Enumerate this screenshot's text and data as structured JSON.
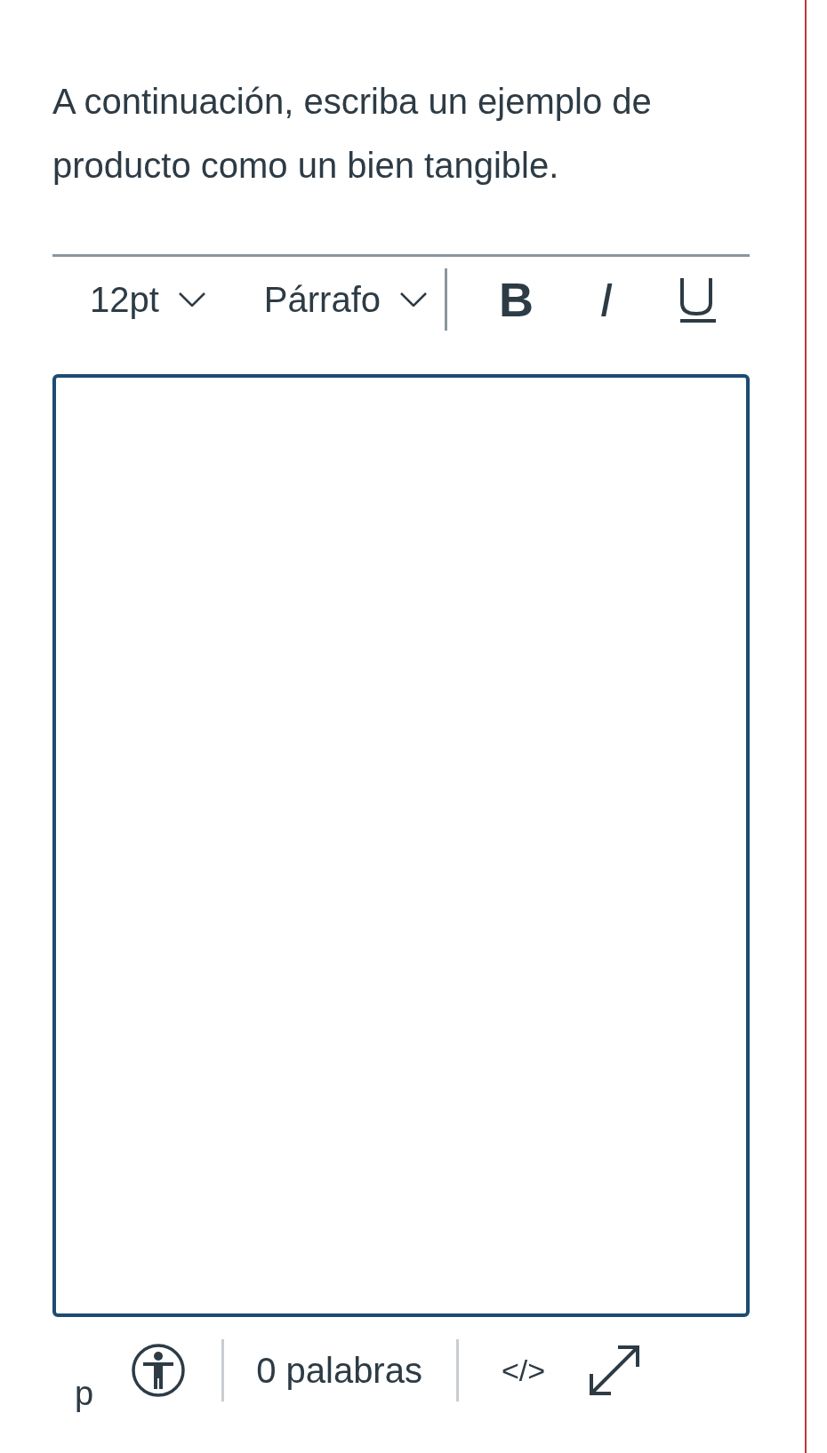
{
  "question": {
    "text": "A continuación, escriba un ejemplo de producto como un bien tangible."
  },
  "toolbar": {
    "items": [
      {
        "kind": "dropdown",
        "label": "12pt"
      },
      {
        "kind": "dropdown",
        "label": "Párrafo"
      },
      {
        "kind": "divider"
      },
      {
        "kind": "bold",
        "label": "B"
      },
      {
        "kind": "italic",
        "label": "I"
      },
      {
        "kind": "underline"
      }
    ]
  },
  "editor": {
    "focused": true
  },
  "status_bar": {
    "path": "p",
    "word_count": "0 palabras",
    "html_toggle": "</>"
  }
}
